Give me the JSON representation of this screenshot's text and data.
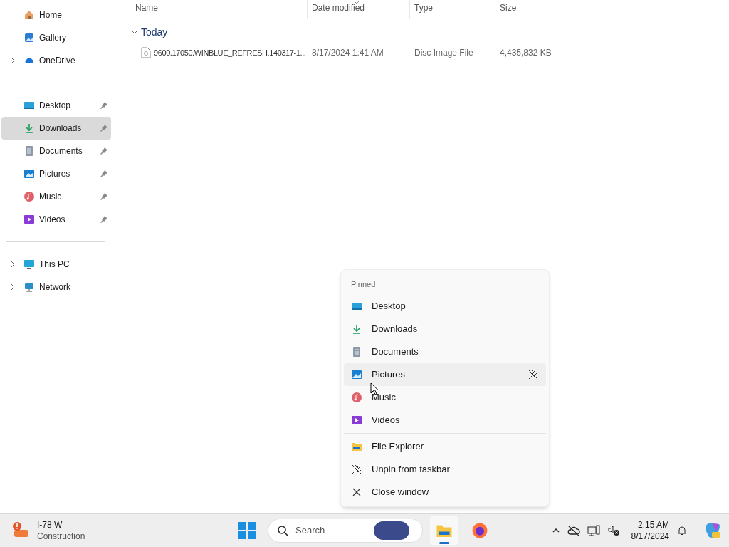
{
  "sidebar": {
    "sections": [
      {
        "items": [
          {
            "label": "Home",
            "kind": "home",
            "expandable": false,
            "pinned": false,
            "selected": false
          },
          {
            "label": "Gallery",
            "kind": "gallery",
            "expandable": false,
            "pinned": false,
            "selected": false
          },
          {
            "label": "OneDrive",
            "kind": "cloud",
            "expandable": true,
            "pinned": false,
            "selected": false
          }
        ]
      },
      {
        "items": [
          {
            "label": "Desktop",
            "kind": "desktop",
            "expandable": false,
            "pinned": true,
            "selected": false
          },
          {
            "label": "Downloads",
            "kind": "download",
            "expandable": false,
            "pinned": true,
            "selected": true
          },
          {
            "label": "Documents",
            "kind": "document",
            "expandable": false,
            "pinned": true,
            "selected": false
          },
          {
            "label": "Pictures",
            "kind": "picture",
            "expandable": false,
            "pinned": true,
            "selected": false
          },
          {
            "label": "Music",
            "kind": "music",
            "expandable": false,
            "pinned": true,
            "selected": false
          },
          {
            "label": "Videos",
            "kind": "video",
            "expandable": false,
            "pinned": true,
            "selected": false
          }
        ]
      },
      {
        "items": [
          {
            "label": "This PC",
            "kind": "pc",
            "expandable": true,
            "pinned": false,
            "selected": false
          },
          {
            "label": "Network",
            "kind": "network",
            "expandable": true,
            "pinned": false,
            "selected": false
          }
        ]
      }
    ]
  },
  "table": {
    "columns": [
      {
        "label": "Name",
        "sorted": false
      },
      {
        "label": "Date modified",
        "sorted": true
      },
      {
        "label": "Type",
        "sorted": false
      },
      {
        "label": "Size",
        "sorted": false
      }
    ],
    "groups": [
      {
        "label": "Today",
        "expanded": true,
        "rows": [
          {
            "name": "9600.17050.WINBLUE_REFRESH.140317-1...",
            "date": "8/17/2024 1:41 AM",
            "type": "Disc Image File",
            "size": "4,435,832 KB"
          }
        ]
      }
    ]
  },
  "jump_list": {
    "heading": "Pinned",
    "pinned": [
      {
        "label": "Desktop",
        "kind": "desktop",
        "hovered": false
      },
      {
        "label": "Downloads",
        "kind": "download",
        "hovered": false
      },
      {
        "label": "Documents",
        "kind": "document",
        "hovered": false
      },
      {
        "label": "Pictures",
        "kind": "picture",
        "hovered": true
      },
      {
        "label": "Music",
        "kind": "music",
        "hovered": false
      },
      {
        "label": "Videos",
        "kind": "video",
        "hovered": false
      }
    ],
    "actions": [
      {
        "label": "File Explorer",
        "kind": "folder"
      },
      {
        "label": "Unpin from taskbar",
        "kind": "unpin"
      },
      {
        "label": "Close window",
        "kind": "close"
      }
    ]
  },
  "taskbar": {
    "widget": {
      "title": "I-78 W",
      "subtitle": "Construction"
    },
    "search": {
      "placeholder": "Search"
    },
    "apps": [
      {
        "kind": "folder",
        "active": true
      },
      {
        "kind": "firefox",
        "active": false
      }
    ],
    "clock": {
      "time": "2:15 AM",
      "date": "8/17/2024"
    }
  }
}
